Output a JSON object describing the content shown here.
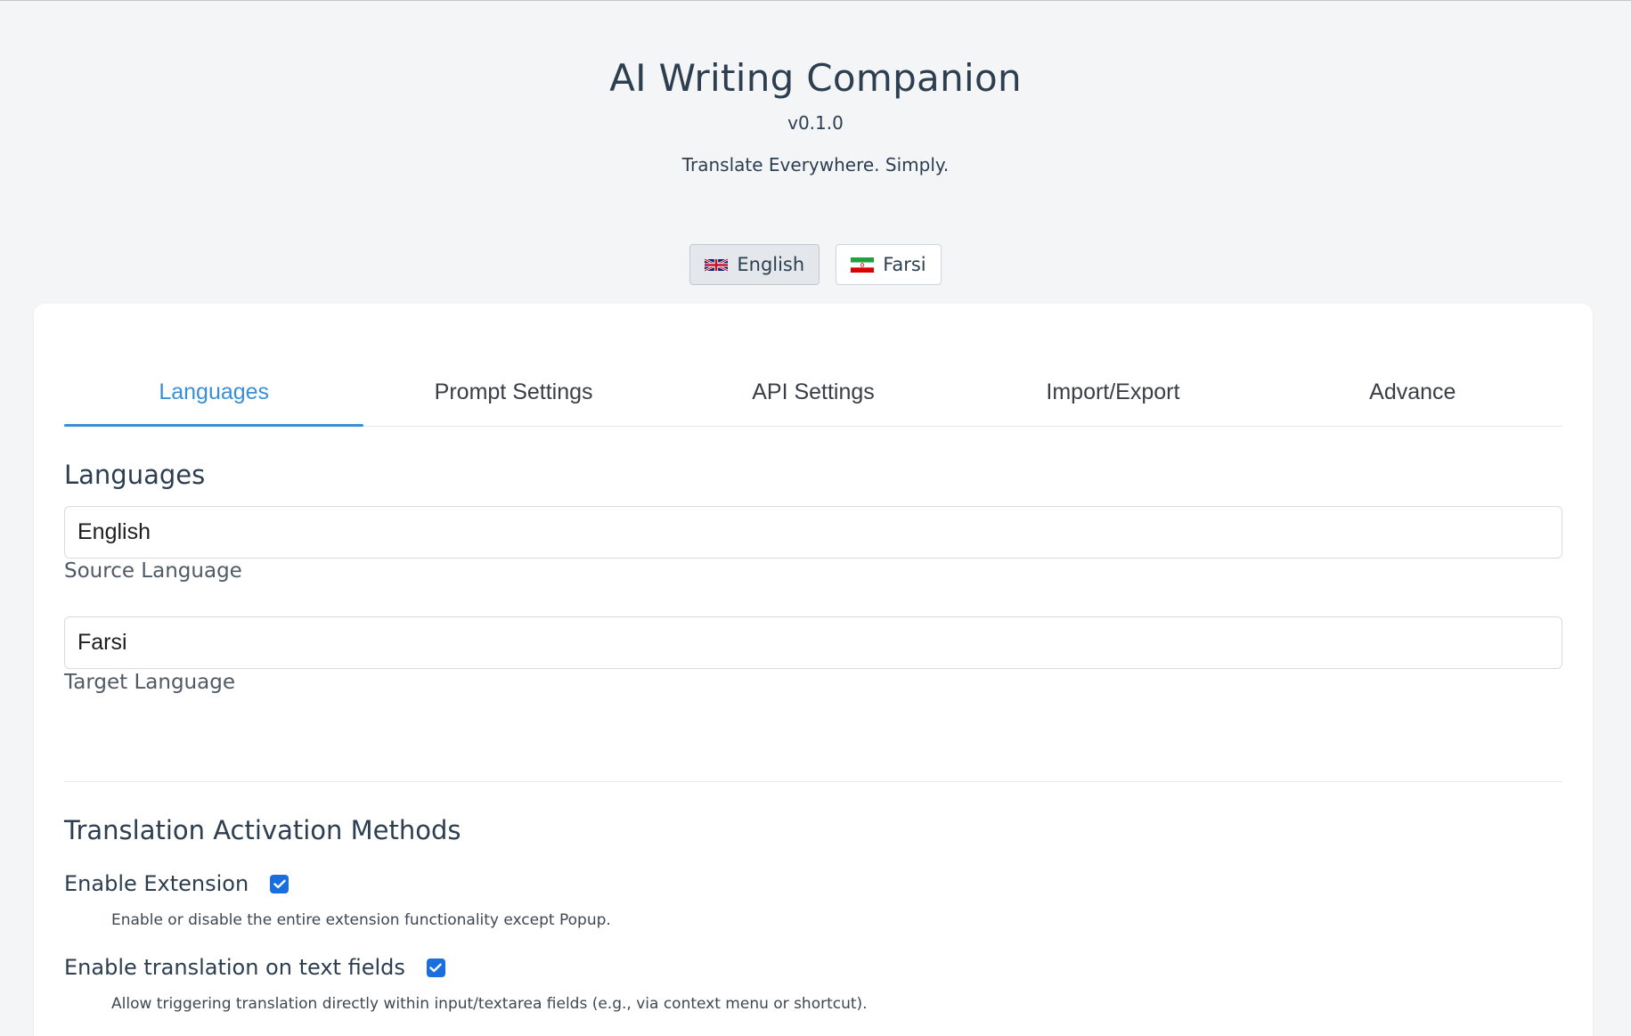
{
  "header": {
    "title": "AI Writing Companion",
    "version": "v0.1.0",
    "tagline": "Translate Everywhere. Simply."
  },
  "ui_language": {
    "options": [
      {
        "label": "English",
        "flag": "uk-flag-icon",
        "active": true
      },
      {
        "label": "Farsi",
        "flag": "iran-flag-icon",
        "active": false
      }
    ]
  },
  "tabs": [
    {
      "label": "Languages",
      "active": true
    },
    {
      "label": "Prompt Settings",
      "active": false
    },
    {
      "label": "API Settings",
      "active": false
    },
    {
      "label": "Import/Export",
      "active": false
    },
    {
      "label": "Advance",
      "active": false
    }
  ],
  "languages_section": {
    "title": "Languages",
    "source": {
      "value": "English",
      "label": "Source Language"
    },
    "target": {
      "value": "Farsi",
      "label": "Target Language"
    }
  },
  "activation_section": {
    "title": "Translation Activation Methods",
    "options": [
      {
        "label": "Enable Extension",
        "checked": true,
        "description": "Enable or disable the entire extension functionality except Popup."
      },
      {
        "label": "Enable translation on text fields",
        "checked": true,
        "description": "Allow triggering translation directly within input/textarea fields (e.g., via context menu or shortcut)."
      }
    ]
  },
  "colors": {
    "accent": "#3b8fd6",
    "checkbox": "#1a6fe0",
    "background": "#f4f5f7",
    "card": "#ffffff"
  }
}
